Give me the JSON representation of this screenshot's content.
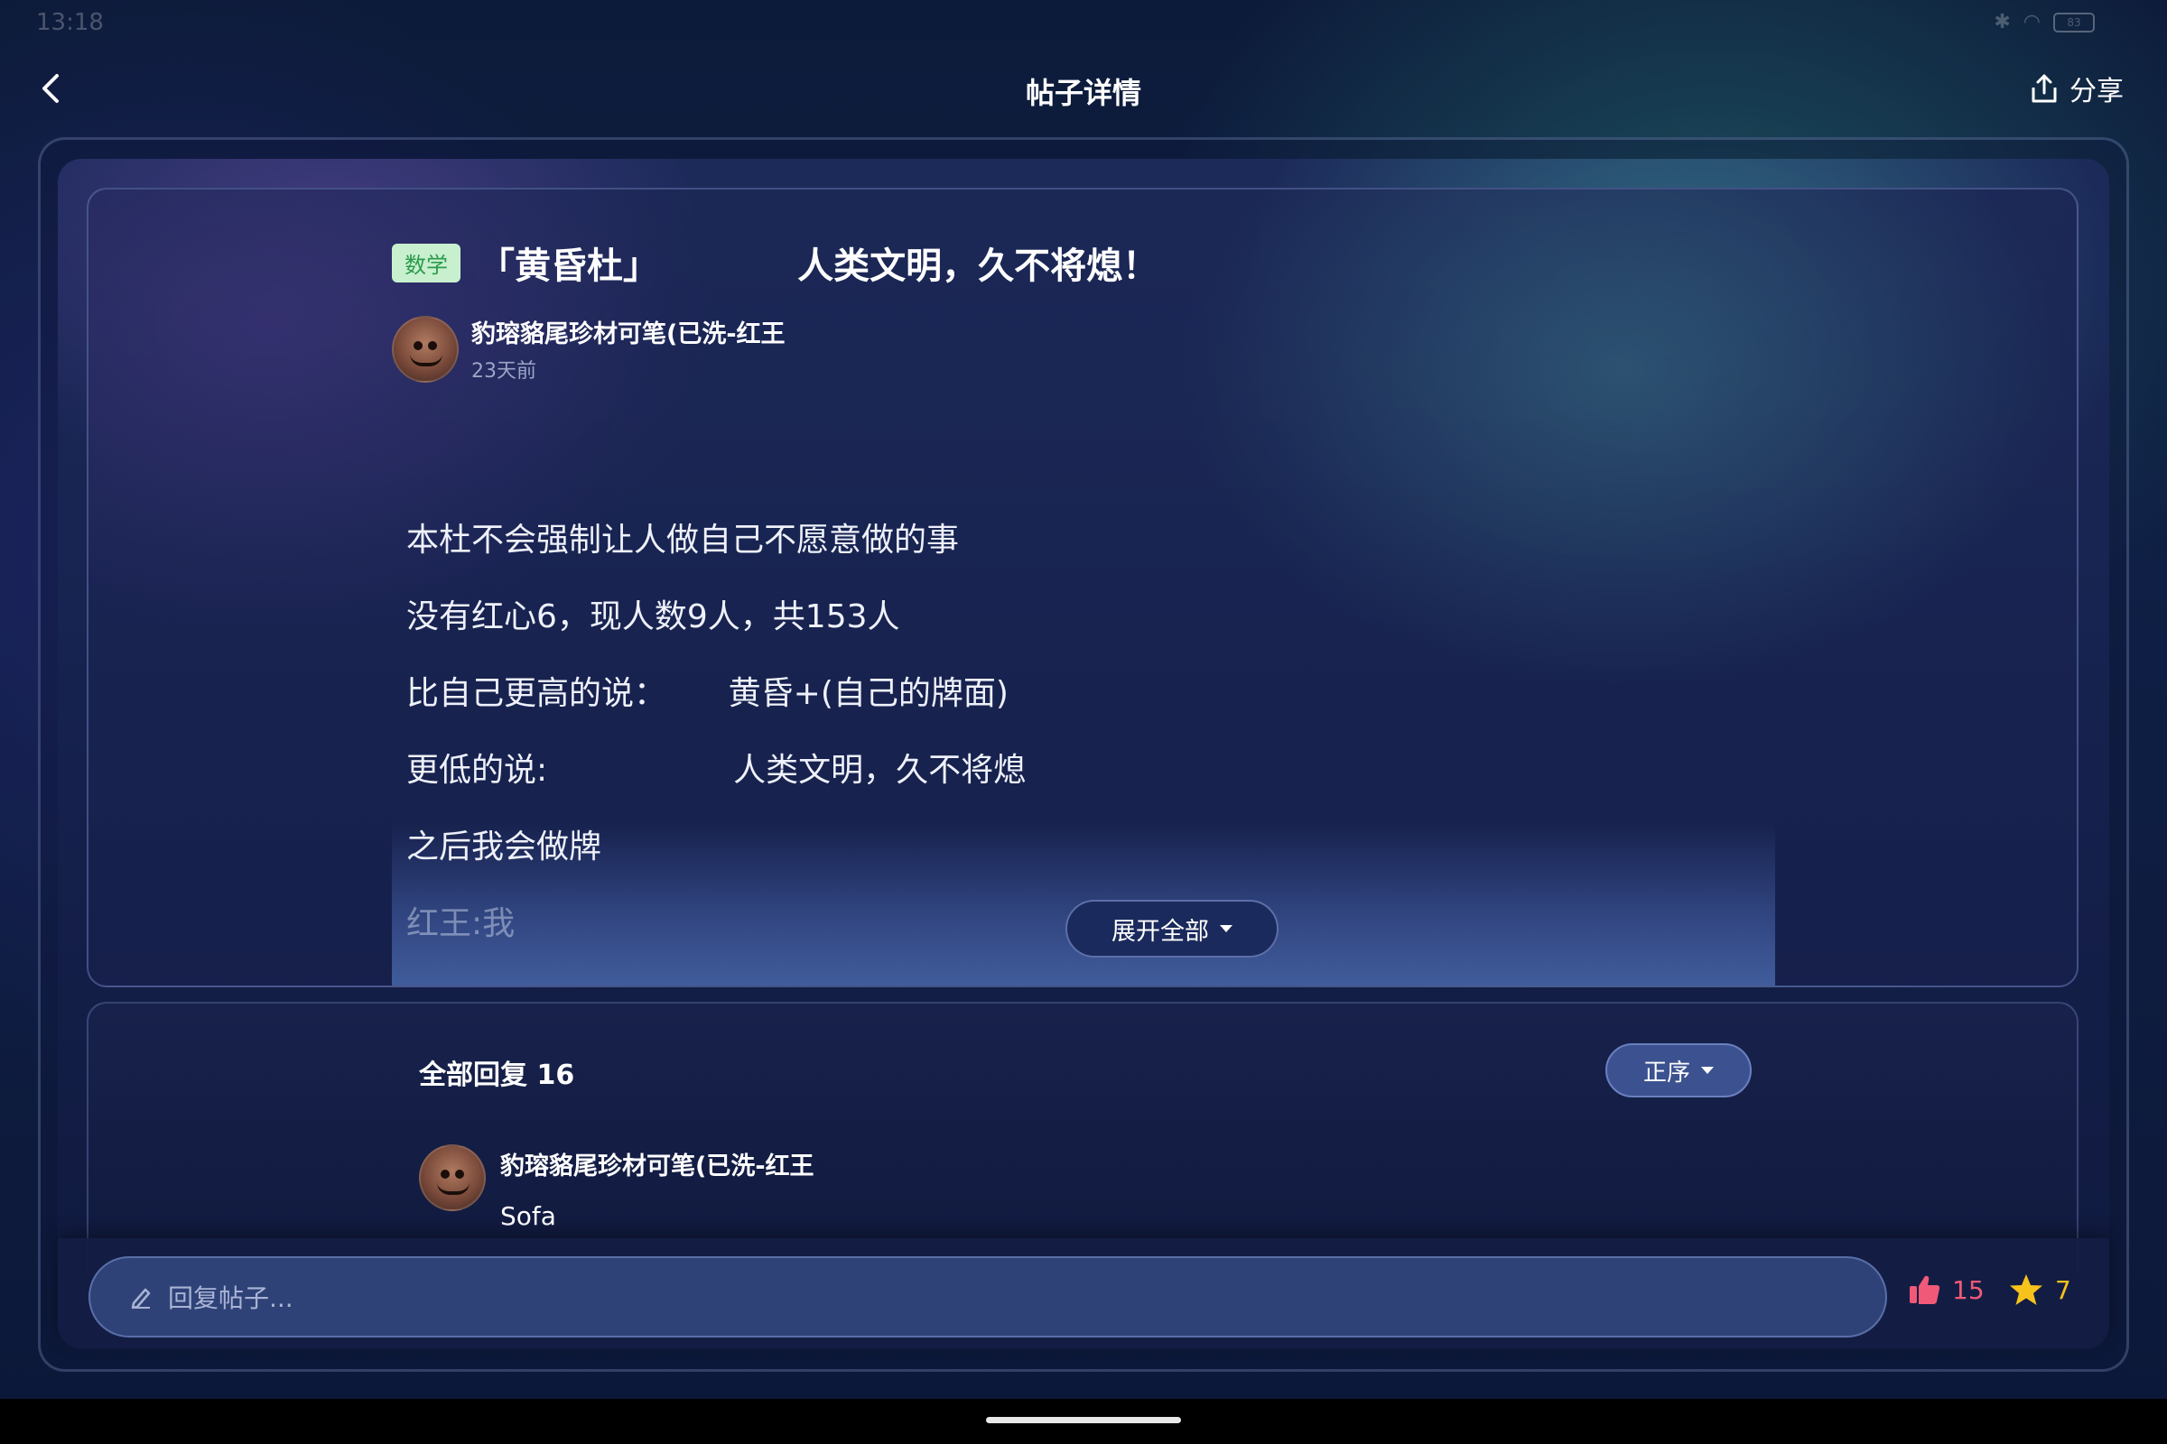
{
  "status_bar": {
    "time": "13:18",
    "battery": "83"
  },
  "header": {
    "title": "帖子详情",
    "share_label": "分享"
  },
  "post": {
    "subject_tag": "数学",
    "title": "「黄昏杜」           人类文明，久不将熄！",
    "author": {
      "name": "豹瑢貉尾珍材可笔(已洗-红王",
      "time": "23天前"
    },
    "body_lines": [
      "本杜不会强制让人做自己不愿意做的事",
      "没有红心6，现人数9人，共153人",
      "比自己更高的说：      黄昏+(自己的牌面)",
      "更低的说:                  人类文明，久不将熄",
      "之后我会做牌",
      "红王:我"
    ],
    "expand_label": "展开全部"
  },
  "replies": {
    "count_label": "全部回复 16",
    "sort_label": "正序",
    "items": [
      {
        "name": "豹瑢貉尾珍材可笔(已洗-红王",
        "text": "Sofa"
      }
    ]
  },
  "bottom_bar": {
    "reply_placeholder": "回复帖子...",
    "like_count": "15",
    "favorite_count": "7"
  },
  "colors": {
    "tag_bg": "#c8f0cf",
    "tag_text": "#2b9a4b",
    "like": "#f05a78",
    "favorite": "#f7c21c"
  }
}
